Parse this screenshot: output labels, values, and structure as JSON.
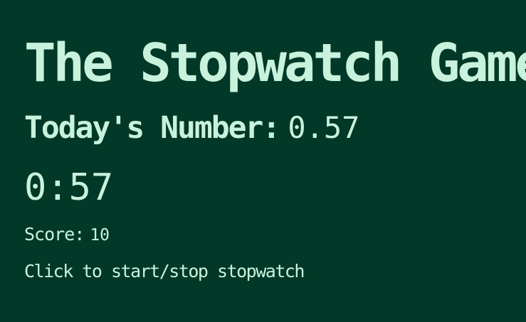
{
  "game": {
    "title": "The Stopwatch Game",
    "today_label": "Today's Number:",
    "today_value": "0.57",
    "timer": "0:57",
    "score_label": "Score:",
    "score_value": "10",
    "instructions": "Click to start/stop stopwatch"
  },
  "colors": {
    "background": "#023827",
    "text": "#c8f2dc"
  }
}
